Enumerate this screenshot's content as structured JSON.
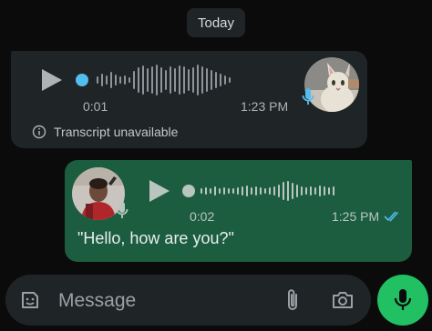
{
  "date_chip": "Today",
  "incoming": {
    "elapsed": "0:01",
    "time": "1:23 PM",
    "transcript_note": "Transcript unavailable",
    "avatar": "cat-photo",
    "play_icon": "play-icon",
    "progress_color": "#53bdeb"
  },
  "outgoing": {
    "elapsed": "0:02",
    "time": "1:25 PM",
    "transcript": "\"Hello, how are you?\"",
    "avatar": "person-photo",
    "status": "read",
    "status_icon": "double-check-icon"
  },
  "composer": {
    "placeholder": "Message",
    "sticker_icon": "sticker-icon",
    "attach_icon": "paperclip-icon",
    "camera_icon": "camera-icon",
    "send_icon": "microphone-icon"
  },
  "colors": {
    "background": "#0b0b0c",
    "bubble_in": "#1f2426",
    "bubble_out": "#1c5d40",
    "accent_green": "#21c063",
    "read_ticks": "#53bdeb"
  }
}
